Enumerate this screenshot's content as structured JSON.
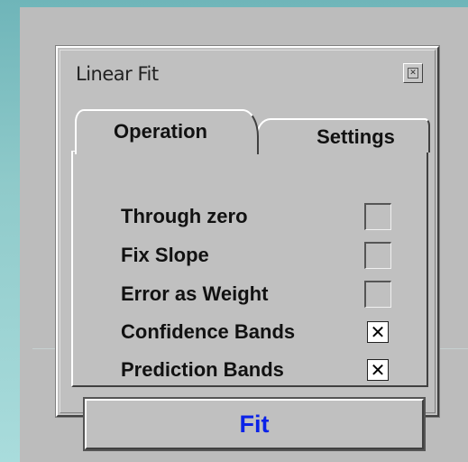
{
  "window": {
    "title": "Linear Fit",
    "close_icon": "close-icon"
  },
  "tabs": [
    {
      "label": "Operation",
      "active": true
    },
    {
      "label": "Settings",
      "active": false
    }
  ],
  "options": [
    {
      "label": "Through zero",
      "checked": false
    },
    {
      "label": "Fix Slope",
      "checked": false
    },
    {
      "label": "Error as Weight",
      "checked": false
    },
    {
      "label": "Confidence Bands",
      "checked": true,
      "mark": "✕"
    },
    {
      "label": "Prediction Bands",
      "checked": true,
      "mark": "✕"
    }
  ],
  "fit_button": {
    "label": "Fit",
    "color": "#0a22e8"
  },
  "colors": {
    "panel": "#c0c0c0",
    "background_gradient_top": "#6fb5b9",
    "background_gradient_bottom": "#a9dcdc"
  }
}
